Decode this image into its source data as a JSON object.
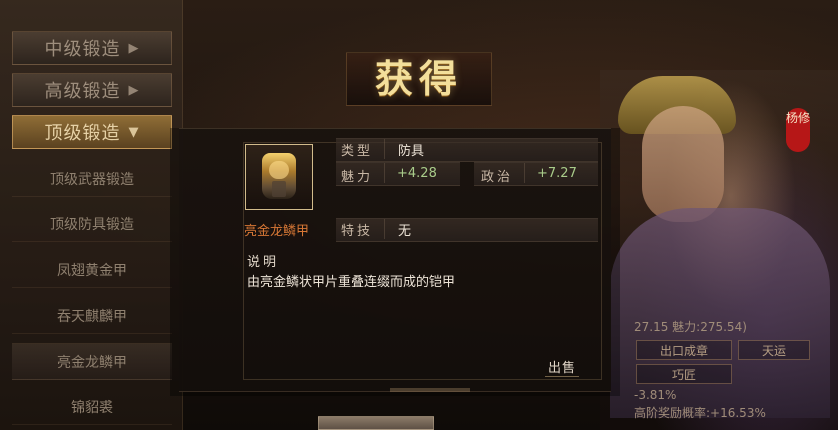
{
  "sidebar": {
    "menu": [
      {
        "label": "中级锻造",
        "arrow": "▶"
      },
      {
        "label": "高级锻造",
        "arrow": "▶"
      },
      {
        "label": "顶级锻造",
        "arrow": "▼"
      }
    ],
    "submenu": [
      {
        "label": "顶级武器锻造"
      },
      {
        "label": "顶级防具锻造"
      },
      {
        "label": "凤翅黄金甲"
      },
      {
        "label": "吞天麒麟甲"
      },
      {
        "label": "亮金龙鳞甲"
      },
      {
        "label": "锦貂裘"
      }
    ]
  },
  "background_panel": {
    "name_tag": "杨修",
    "stats_line": "27.15 魅力:275.54)",
    "buttons": [
      {
        "label": "出口成章"
      },
      {
        "label": "天运"
      },
      {
        "label": "巧匠"
      }
    ],
    "line_2": "-3.81%",
    "line_3": "高阶奖励概率:+16.53%"
  },
  "modal": {
    "title": "获得",
    "item": {
      "name": "亮金龙鳞甲",
      "icon": "armor-icon"
    },
    "type_label": "类型",
    "type_value": "防具",
    "charm_label": "魅力",
    "charm_value": "+4.28",
    "politics_label": "政治",
    "politics_value": "+7.27",
    "skill_label": "特技",
    "skill_value": "无",
    "desc_label": "说明",
    "desc_text": "由亮金鳞状甲片重叠连缀而成的铠甲",
    "sell_label": "出售"
  },
  "colors": {
    "item_name": "#d77735",
    "green_value": "#a9cc8a",
    "title_gold": "#f3df9b"
  }
}
